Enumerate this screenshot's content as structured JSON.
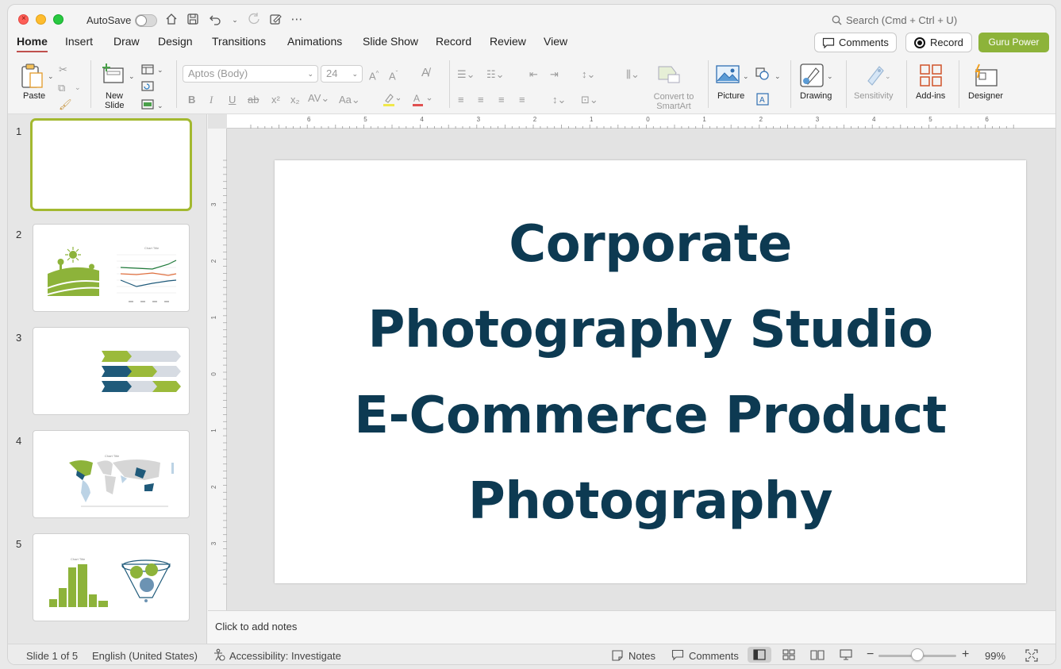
{
  "titlebar": {
    "autosave_label": "AutoSave",
    "search_placeholder": "Search (Cmd + Ctrl + U)"
  },
  "tabs": [
    {
      "label": "Home"
    },
    {
      "label": "Insert"
    },
    {
      "label": "Draw"
    },
    {
      "label": "Design"
    },
    {
      "label": "Transitions"
    },
    {
      "label": "Animations"
    },
    {
      "label": "Slide Show"
    },
    {
      "label": "Record"
    },
    {
      "label": "Review"
    },
    {
      "label": "View"
    }
  ],
  "header_buttons": {
    "comments": "Comments",
    "record": "Record",
    "guru": "Guru Power"
  },
  "ribbon": {
    "paste": "Paste",
    "new_slide_1": "New",
    "new_slide_2": "Slide",
    "font_name": "Aptos (Body)",
    "font_size": "24",
    "convert_1": "Convert to",
    "convert_2": "SmartArt",
    "picture": "Picture",
    "drawing": "Drawing",
    "sensitivity": "Sensitivity",
    "addins": "Add-ins",
    "designer": "Designer"
  },
  "thumbnails": [
    {
      "num": "1"
    },
    {
      "num": "2"
    },
    {
      "num": "3"
    },
    {
      "num": "4"
    },
    {
      "num": "5"
    }
  ],
  "slide": {
    "title_lines": [
      "Corporate",
      "Photography Studio",
      "E-Commerce Product",
      "Photography"
    ]
  },
  "ruler": {
    "h_ticks": [
      "6",
      "5",
      "4",
      "3",
      "2",
      "1",
      "0",
      "1",
      "2",
      "3",
      "4",
      "5",
      "6"
    ],
    "v_ticks": [
      "3",
      "2",
      "1",
      "0",
      "1",
      "2",
      "3"
    ]
  },
  "notes": {
    "placeholder": "Click to add notes"
  },
  "status": {
    "slide_of": "Slide 1 of 5",
    "language": "English (United States)",
    "accessibility": "Accessibility: Investigate",
    "notes": "Notes",
    "comments": "Comments",
    "zoom": "99%"
  },
  "colors": {
    "title_text": "#0d3a52",
    "accent_green": "#8db33a",
    "selected_thumb_border": "#a3b930",
    "thumb_navy": "#1f5a7a"
  }
}
